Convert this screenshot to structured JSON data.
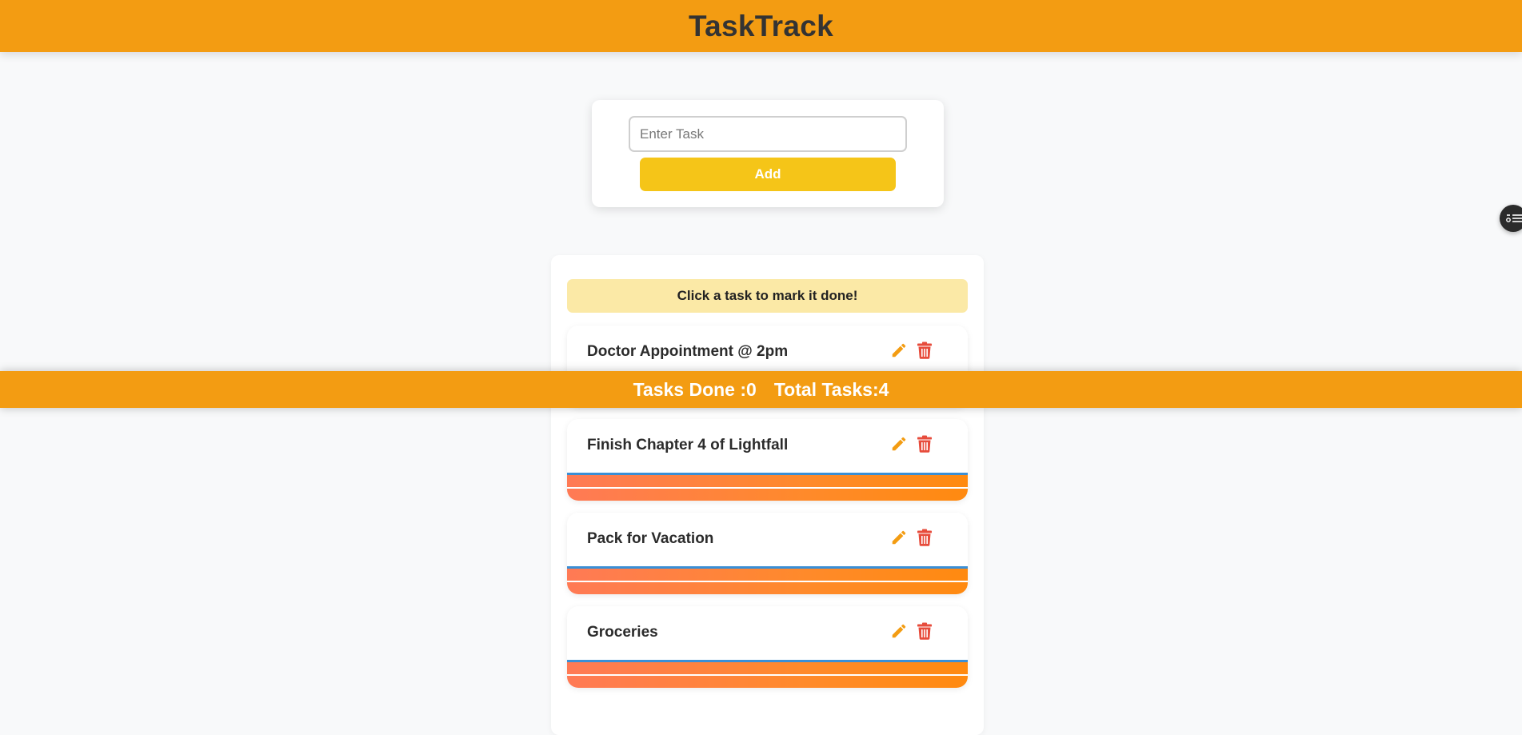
{
  "app": {
    "title": "TaskTrack"
  },
  "add_form": {
    "input_placeholder": "Enter Task",
    "input_value": "",
    "add_label": "Add"
  },
  "list": {
    "hint": "Click a task to mark it done!",
    "tasks": [
      {
        "text": "Doctor Appointment @ 2pm",
        "done": false
      },
      {
        "text": "Finish Chapter 4 of Lightfall",
        "done": false
      },
      {
        "text": "Pack for Vacation",
        "done": false
      },
      {
        "text": "Groceries",
        "done": false
      }
    ]
  },
  "stats": {
    "done_label": "Tasks Done :0",
    "total_label": "Total Tasks:4"
  },
  "icons": {
    "edit": "pencil-icon",
    "delete": "trash-icon",
    "side_button": "list-settings-icon"
  },
  "colors": {
    "header": "#f39c12",
    "add_button": "#f5c518",
    "hint_background": "#fbe9a6",
    "edit_icon": "#f39c12",
    "delete_icon": "#e74c3c"
  }
}
